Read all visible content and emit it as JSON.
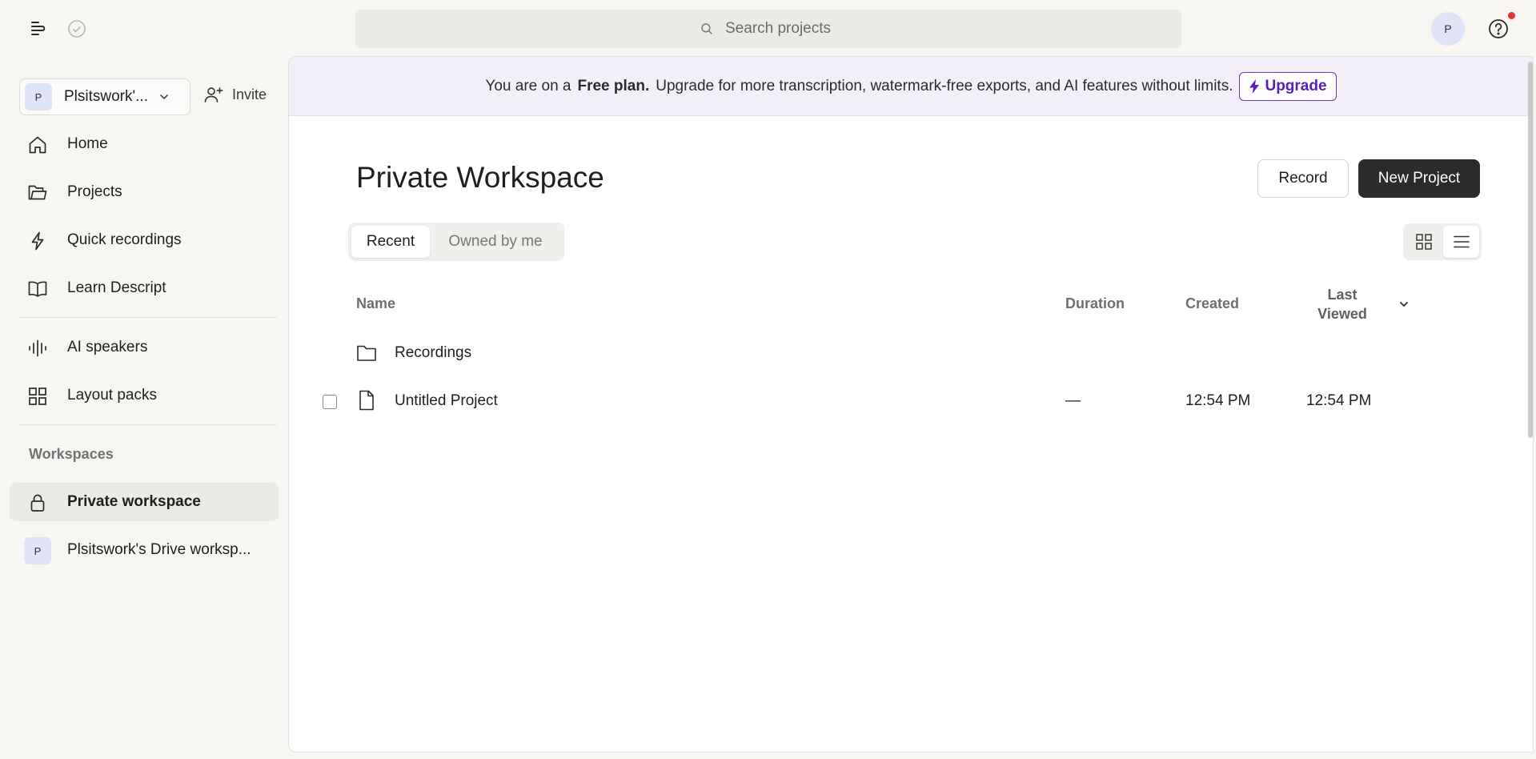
{
  "topbar": {
    "search_placeholder": "Search projects",
    "avatar_initial": "P"
  },
  "sidebar": {
    "workspace_switcher": {
      "initial": "P",
      "name": "Plsitswork'..."
    },
    "invite_label": "Invite",
    "nav_items": [
      {
        "label": "Home",
        "icon": "home-icon"
      },
      {
        "label": "Projects",
        "icon": "folder-icon"
      },
      {
        "label": "Quick recordings",
        "icon": "lightning-icon"
      },
      {
        "label": "Learn Descript",
        "icon": "book-icon"
      }
    ],
    "extra_items": [
      {
        "label": "AI speakers",
        "icon": "waveform-icon"
      },
      {
        "label": "Layout packs",
        "icon": "grid-icon"
      }
    ],
    "workspaces_heading": "Workspaces",
    "workspaces": [
      {
        "label": "Private workspace",
        "icon": "lock-icon",
        "active": true
      },
      {
        "label": "Plsitswork's Drive worksp...",
        "initial": "P",
        "active": false
      }
    ]
  },
  "banner": {
    "prefix": "You are on a",
    "plan": "Free plan.",
    "message": "Upgrade for more transcription, watermark-free exports, and AI features without limits.",
    "upgrade_label": "Upgrade"
  },
  "main": {
    "title": "Private Workspace",
    "record_label": "Record",
    "new_project_label": "New Project",
    "tabs": [
      {
        "label": "Recent",
        "active": true
      },
      {
        "label": "Owned by me",
        "active": false
      }
    ],
    "view_modes": [
      "grid-view-icon",
      "list-view-icon"
    ],
    "active_view": "list"
  },
  "table": {
    "headers": {
      "name": "Name",
      "duration": "Duration",
      "created": "Created",
      "last_viewed_line1": "Last",
      "last_viewed_line2": "Viewed"
    },
    "rows": [
      {
        "type": "folder",
        "name": "Recordings",
        "duration": "",
        "created": "",
        "last_viewed": ""
      },
      {
        "type": "file",
        "name": "Untitled Project",
        "duration": "—",
        "created": "12:54 PM",
        "last_viewed": "12:54 PM"
      }
    ]
  },
  "colors": {
    "accent_purple": "#5a1fb8",
    "banner_bg": "#f3eff9",
    "primary_button": "#2b2b2b",
    "notification_dot": "#e5303a"
  }
}
